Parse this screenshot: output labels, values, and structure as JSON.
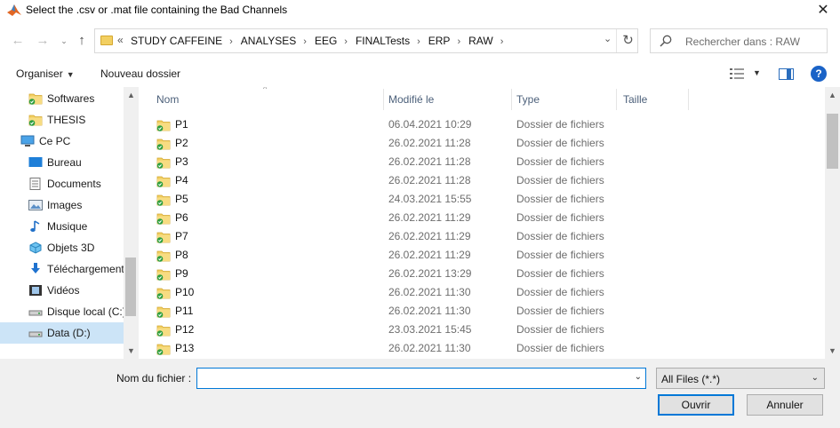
{
  "window": {
    "title": "Select the .csv or .mat file containing the Bad Channels",
    "close_label": "✕"
  },
  "address": {
    "back_glyph": "←",
    "forward_glyph": "→",
    "up_glyph": "↑",
    "overflow_glyph": "«",
    "crumbs": [
      "STUDY CAFFEINE",
      "ANALYSES",
      "EEG",
      "FINALTests",
      "ERP",
      "RAW"
    ],
    "refresh_glyph": "↻",
    "search_placeholder": "Rechercher dans : RAW"
  },
  "commands": {
    "organize_label": "Organiser",
    "new_folder_label": "Nouveau dossier"
  },
  "nav": {
    "items": [
      {
        "label": "Softwares",
        "icon": "folder-icon",
        "indent": 1,
        "selected": false
      },
      {
        "label": "THESIS",
        "icon": "folder-icon",
        "indent": 1,
        "selected": false
      },
      {
        "label": "Ce PC",
        "icon": "computer-icon",
        "indent": 0,
        "selected": false
      },
      {
        "label": "Bureau",
        "icon": "desktop-icon",
        "indent": 1,
        "selected": false
      },
      {
        "label": "Documents",
        "icon": "documents-icon",
        "indent": 1,
        "selected": false
      },
      {
        "label": "Images",
        "icon": "images-icon",
        "indent": 1,
        "selected": false
      },
      {
        "label": "Musique",
        "icon": "music-icon",
        "indent": 1,
        "selected": false
      },
      {
        "label": "Objets 3D",
        "icon": "objects3d-icon",
        "indent": 1,
        "selected": false
      },
      {
        "label": "Téléchargement",
        "icon": "download-icon",
        "indent": 1,
        "selected": false
      },
      {
        "label": "Vidéos",
        "icon": "videos-icon",
        "indent": 1,
        "selected": false
      },
      {
        "label": "Disque local (C:)",
        "icon": "drive-icon",
        "indent": 1,
        "selected": false
      },
      {
        "label": "Data (D:)",
        "icon": "drive-icon",
        "indent": 1,
        "selected": true
      }
    ]
  },
  "columns": {
    "name": "Nom",
    "modified": "Modifié le",
    "type": "Type",
    "size": "Taille"
  },
  "files": [
    {
      "name": "P1",
      "modified": "06.04.2021 10:29",
      "type": "Dossier de fichiers"
    },
    {
      "name": "P2",
      "modified": "26.02.2021 11:28",
      "type": "Dossier de fichiers"
    },
    {
      "name": "P3",
      "modified": "26.02.2021 11:28",
      "type": "Dossier de fichiers"
    },
    {
      "name": "P4",
      "modified": "26.02.2021 11:28",
      "type": "Dossier de fichiers"
    },
    {
      "name": "P5",
      "modified": "24.03.2021 15:55",
      "type": "Dossier de fichiers"
    },
    {
      "name": "P6",
      "modified": "26.02.2021 11:29",
      "type": "Dossier de fichiers"
    },
    {
      "name": "P7",
      "modified": "26.02.2021 11:29",
      "type": "Dossier de fichiers"
    },
    {
      "name": "P8",
      "modified": "26.02.2021 11:29",
      "type": "Dossier de fichiers"
    },
    {
      "name": "P9",
      "modified": "26.02.2021 13:29",
      "type": "Dossier de fichiers"
    },
    {
      "name": "P10",
      "modified": "26.02.2021 11:30",
      "type": "Dossier de fichiers"
    },
    {
      "name": "P11",
      "modified": "26.02.2021 11:30",
      "type": "Dossier de fichiers"
    },
    {
      "name": "P12",
      "modified": "23.03.2021 15:45",
      "type": "Dossier de fichiers"
    },
    {
      "name": "P13",
      "modified": "26.02.2021 11:30",
      "type": "Dossier de fichiers"
    }
  ],
  "footer": {
    "filename_label": "Nom du fichier :",
    "filename_value": "",
    "filter_value": "All Files (*.*)",
    "open_label": "Ouvrir",
    "cancel_label": "Annuler"
  },
  "colors": {
    "accent": "#0078d7",
    "folder": "#f2cf61",
    "selection": "#cce4f7",
    "sync_check": "#2e9e3e"
  }
}
